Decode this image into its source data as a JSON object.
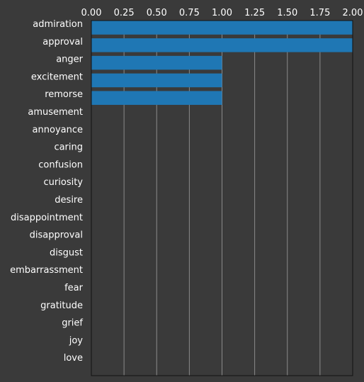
{
  "chart_data": {
    "type": "bar",
    "orientation": "horizontal",
    "categories": [
      "admiration",
      "approval",
      "anger",
      "excitement",
      "remorse",
      "amusement",
      "annoyance",
      "caring",
      "confusion",
      "curiosity",
      "desire",
      "disappointment",
      "disapproval",
      "disgust",
      "embarrassment",
      "fear",
      "gratitude",
      "grief",
      "joy",
      "love"
    ],
    "values": [
      2,
      2,
      1,
      1,
      1,
      0,
      0,
      0,
      0,
      0,
      0,
      0,
      0,
      0,
      0,
      0,
      0,
      0,
      0,
      0
    ],
    "x_ticks": [
      "0.00",
      "0.25",
      "0.50",
      "0.75",
      "1.00",
      "1.25",
      "1.50",
      "1.75",
      "2.00"
    ],
    "xlim": [
      0,
      2.0
    ],
    "x_axis_position": "top",
    "grid": "vertical",
    "colors": {
      "background": "#3a3a3a",
      "bar": "#1f77b4",
      "grid": "#8a8a8a",
      "axis": "#111111",
      "text": "#ffffff"
    }
  }
}
